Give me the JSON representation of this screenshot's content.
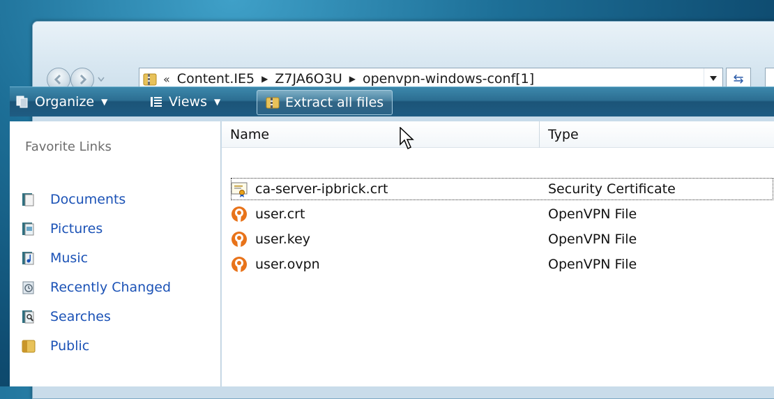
{
  "nav": {
    "back_icon": "back-arrow-icon",
    "forward_icon": "forward-arrow-icon",
    "address": {
      "prefix": "«",
      "crumbs": [
        "Content.IE5",
        "Z7JA6O3U",
        "openvpn-windows-conf[1]"
      ]
    }
  },
  "toolbar": {
    "organize_label": "Organize",
    "views_label": "Views",
    "extract_label": "Extract all files"
  },
  "sidebar": {
    "title": "Favorite Links",
    "items": [
      {
        "label": "Documents",
        "icon": "documents-icon"
      },
      {
        "label": "Pictures",
        "icon": "pictures-icon"
      },
      {
        "label": "Music",
        "icon": "music-icon"
      },
      {
        "label": "Recently Changed",
        "icon": "recently-changed-icon"
      },
      {
        "label": "Searches",
        "icon": "searches-icon"
      },
      {
        "label": "Public",
        "icon": "public-folder-icon"
      }
    ]
  },
  "file_list": {
    "columns": [
      "Name",
      "Type"
    ],
    "rows": [
      {
        "name": "ca-server-ipbrick.crt",
        "type": "Security Certificate",
        "icon": "certificate-icon"
      },
      {
        "name": "user.crt",
        "type": "OpenVPN File",
        "icon": "openvpn-icon"
      },
      {
        "name": "user.key",
        "type": "OpenVPN File",
        "icon": "openvpn-icon"
      },
      {
        "name": "user.ovpn",
        "type": "OpenVPN File",
        "icon": "openvpn-icon"
      }
    ]
  },
  "colors": {
    "link": "#1b52b6",
    "command_bar": "#2c6e92",
    "openvpn_orange": "#e8731a"
  }
}
